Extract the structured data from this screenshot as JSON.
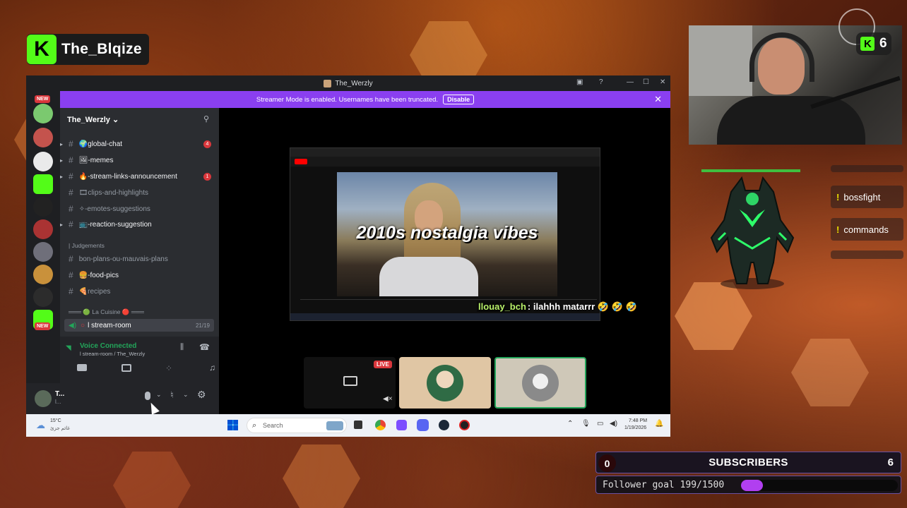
{
  "stream": {
    "streamer": "The_Blqize",
    "kick_count": "6",
    "commands": [
      "bossfight",
      "commands"
    ],
    "subscribers": {
      "left": "0",
      "label": "SUBSCRIBERS",
      "right": "6"
    },
    "follower_goal": {
      "text": "Follower goal 199/1500",
      "current": 199,
      "target": 1500
    },
    "chat_line": {
      "user": "llouay_bch",
      "message": ": ilahhh matarrr 🤣 🤣 🤣"
    },
    "colors": {
      "kick_green": "#53fc18",
      "goal_purple": "#b13ff0"
    }
  },
  "discord": {
    "window_title": "The_Werzly",
    "banner": {
      "text": "Streamer Mode is enabled. Usernames have been truncated.",
      "button": "Disable"
    },
    "server_name": "The_Werzly",
    "new_tag": "NEW",
    "channels": [
      {
        "name": "🌍global-chat",
        "badge": "4",
        "bright": true,
        "arrow": true
      },
      {
        "name": "🖼-memes",
        "badge": "",
        "bright": true,
        "arrow": true
      },
      {
        "name": "🔥-stream-links-announcement",
        "badge": "1",
        "bright": true,
        "arrow": true
      },
      {
        "name": "🎞clips-and-highlights",
        "badge": "",
        "bright": false,
        "arrow": false
      },
      {
        "name": "✧-emotes-suggestions",
        "badge": "",
        "bright": false,
        "arrow": false
      },
      {
        "name": "📺-reaction-suggestion",
        "badge": "",
        "bright": true,
        "arrow": true
      }
    ],
    "category_1": "| Judgements",
    "channels_2": [
      {
        "name": "bon-plans-ou-mauvais-plans",
        "bright": false
      },
      {
        "name": "🍔-food-pics",
        "bright": true
      },
      {
        "name": "🍕recipes",
        "bright": false
      }
    ],
    "category_2": "═══ 🟢 La Cuisine 🔴 ═══",
    "voice_channel": {
      "name": "l stream-room",
      "count": "21/19"
    },
    "voice_status": {
      "title": "Voice Connected",
      "sub": "l stream-room / The_Werzly"
    },
    "user": {
      "name": "T...",
      "status": "l..."
    }
  },
  "youtube": {
    "overlay_text": "2010s nostalgia vibes",
    "live": "LIVE"
  },
  "taskbar": {
    "weather_temp": "15°C",
    "weather_desc": "غائم جزئ",
    "search": "Search",
    "time": "7:48 PM",
    "date": "1/19/2026"
  }
}
